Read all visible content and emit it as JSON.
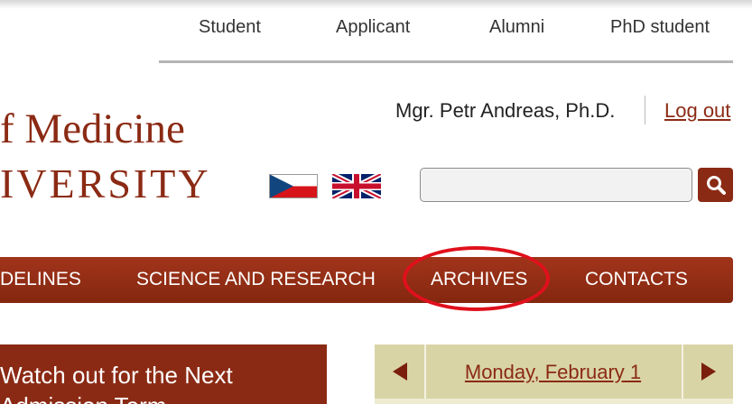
{
  "audience_nav": {
    "items": [
      "Student",
      "Applicant",
      "Alumni",
      "PhD student"
    ]
  },
  "logo": {
    "line1": "f Medicine",
    "line2": "IVERSITY"
  },
  "user": {
    "name": "Mgr. Petr Andreas, Ph.D.",
    "logout_label": "Log out"
  },
  "language": {
    "flags": [
      "czech-flag-icon",
      "uk-flag-icon"
    ]
  },
  "search": {
    "value": "",
    "placeholder": "",
    "icon": "search-icon"
  },
  "main_nav": {
    "items": [
      "DELINES",
      "SCIENCE AND RESEARCH",
      "ARCHIVES",
      "CONTACTS"
    ],
    "highlighted": "ARCHIVES"
  },
  "news": {
    "title": "Watch out for the Next Admission Term"
  },
  "calendar": {
    "date_label": "Monday, February 1",
    "prev_icon": "triangle-left-icon",
    "next_icon": "triangle-right-icon"
  },
  "colors": {
    "brand": "#8b2a14",
    "nav_gradient_top": "#a1341a",
    "highlight_ellipse": "#e0101c",
    "calendar_header": "#d9d4a6",
    "calendar_body": "#eeebd0"
  }
}
